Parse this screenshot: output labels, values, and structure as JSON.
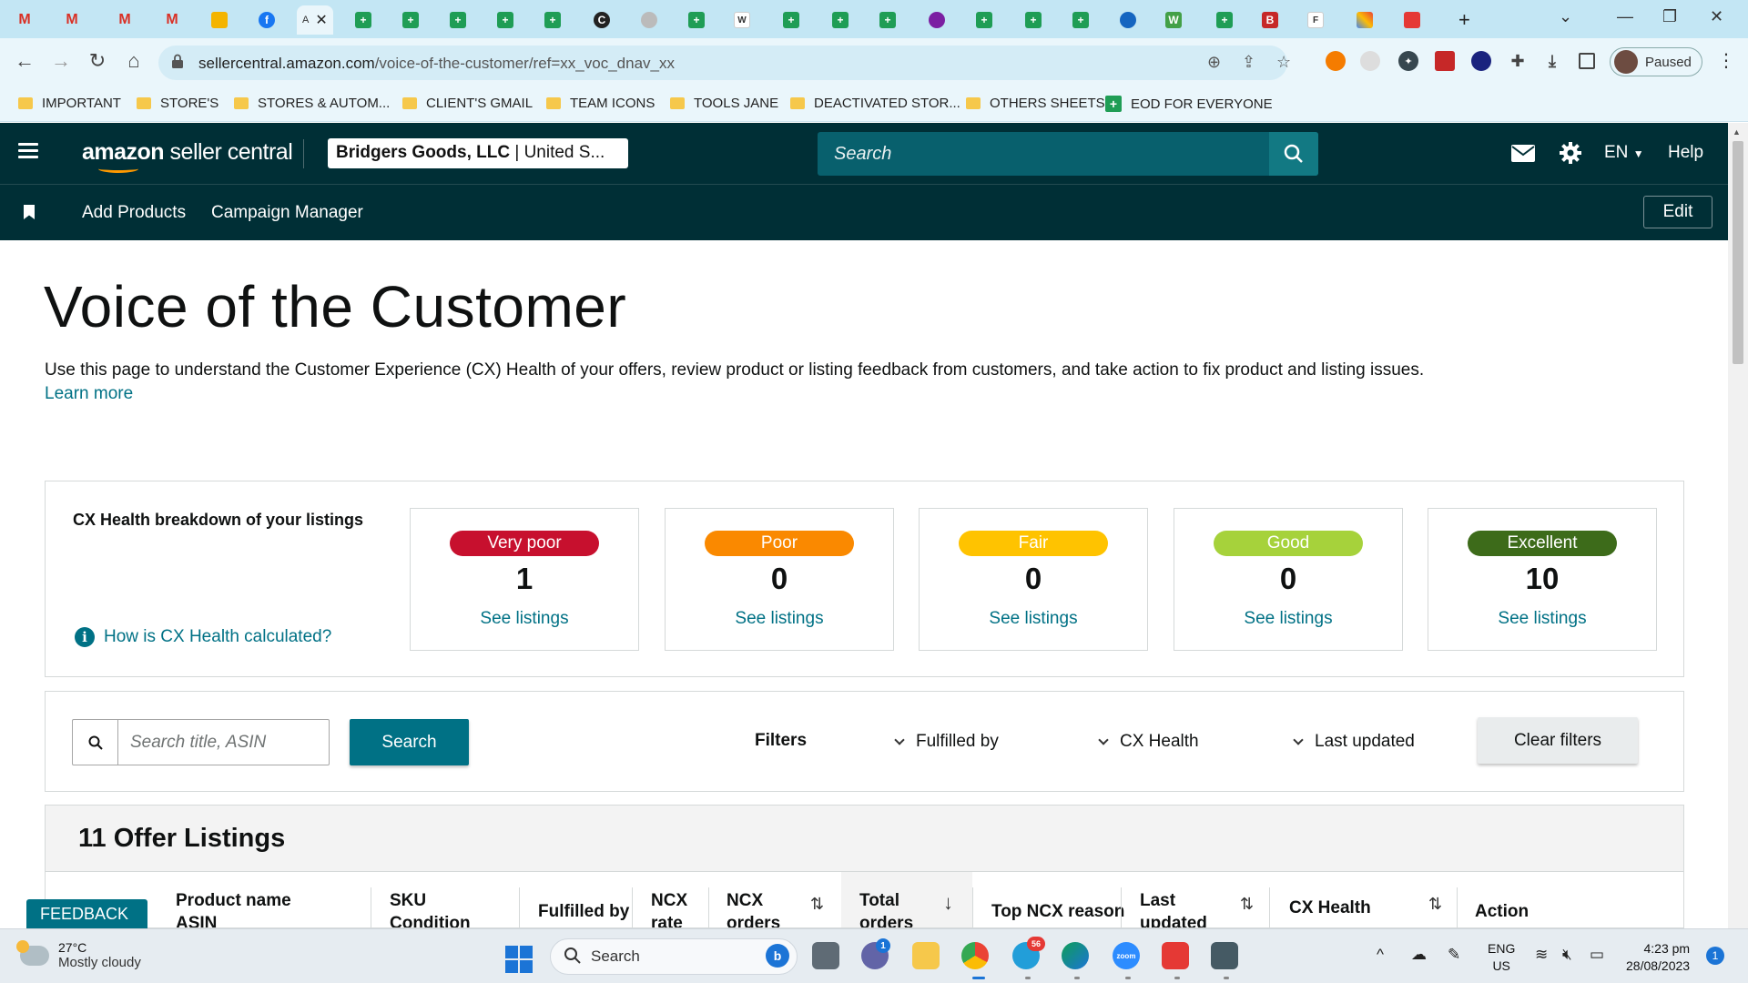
{
  "browser": {
    "active_tab_label": "A",
    "url_host": "sellercentral.amazon.com",
    "url_path": "/voice-of-the-customer/ref=xx_voc_dnav_xx",
    "profile_status": "Paused",
    "bookmarks": [
      {
        "label": "IMPORTANT"
      },
      {
        "label": "STORE'S"
      },
      {
        "label": "STORES & AUTOM..."
      },
      {
        "label": "CLIENT'S GMAIL"
      },
      {
        "label": "TEAM ICONS"
      },
      {
        "label": "TOOLS JANE"
      },
      {
        "label": "DEACTIVATED STOR..."
      },
      {
        "label": "OTHERS SHEETS"
      },
      {
        "label": "EOD FOR EVERYONE"
      }
    ]
  },
  "header": {
    "logo_bold": "amazon",
    "logo_rest": " seller central",
    "account_name": "Bridgers Goods, LLC",
    "account_region": " | United S...",
    "search_placeholder": "Search",
    "language": "EN",
    "help": "Help"
  },
  "nav": {
    "links": [
      "Add Products",
      "Campaign Manager"
    ],
    "edit": "Edit"
  },
  "page": {
    "title": "Voice of the Customer",
    "intro": "Use this page to understand the Customer Experience (CX) Health of your offers, review product or listing feedback from customers, and take action to fix product and listing issues.",
    "learn_more": "Learn more"
  },
  "cx_health": {
    "heading": "CX Health breakdown of your listings",
    "how_link": "How is CX Health calculated?",
    "info_glyph": "i",
    "cards": [
      {
        "label": "Very poor",
        "count": "1",
        "link": "See listings",
        "color": "#c7102e"
      },
      {
        "label": "Poor",
        "count": "0",
        "link": "See listings",
        "color": "#fa8900"
      },
      {
        "label": "Fair",
        "count": "0",
        "link": "See listings",
        "color": "#ffc300"
      },
      {
        "label": "Good",
        "count": "0",
        "link": "See listings",
        "color": "#a6d23b"
      },
      {
        "label": "Excellent",
        "count": "10",
        "link": "See listings",
        "color": "#3d6b1a"
      }
    ]
  },
  "filters": {
    "search_placeholder": "Search title, ASIN",
    "search_button": "Search",
    "label": "Filters",
    "dropdowns": [
      "Fulfilled by",
      "CX Health",
      "Last updated"
    ],
    "clear": "Clear filters"
  },
  "listings": {
    "title": "11 Offer Listings",
    "columns": [
      {
        "line1": "Product name",
        "line2": "ASIN"
      },
      {
        "line1": "SKU",
        "line2": "Condition"
      },
      {
        "line1": "Fulfilled by",
        "line2": ""
      },
      {
        "line1": "NCX",
        "line2": "rate"
      },
      {
        "line1": "NCX",
        "line2": "orders"
      },
      {
        "line1": "Total",
        "line2": "orders"
      },
      {
        "line1": "Top NCX reason",
        "line2": ""
      },
      {
        "line1": "Last",
        "line2": "updated"
      },
      {
        "line1": "CX Health",
        "line2": ""
      },
      {
        "line1": "Action",
        "line2": ""
      }
    ],
    "sort_glyph": "⇅",
    "sort_desc_glyph": "↓"
  },
  "feedback": {
    "label": "FEEDBACK",
    "close": "×"
  },
  "taskbar": {
    "temperature": "27°C",
    "weather": "Mostly cloudy",
    "search": "Search",
    "lang_line1": "ENG",
    "lang_line2": "US",
    "time": "4:23 pm",
    "date": "28/08/2023",
    "notifications": "1",
    "telegram_badge": "56",
    "teams_badge": "1",
    "zoom_label": "zoom",
    "bing_label": "b"
  },
  "colors": {
    "header_bg": "#002f36",
    "link": "#007185",
    "search_bg": "#08606d"
  }
}
